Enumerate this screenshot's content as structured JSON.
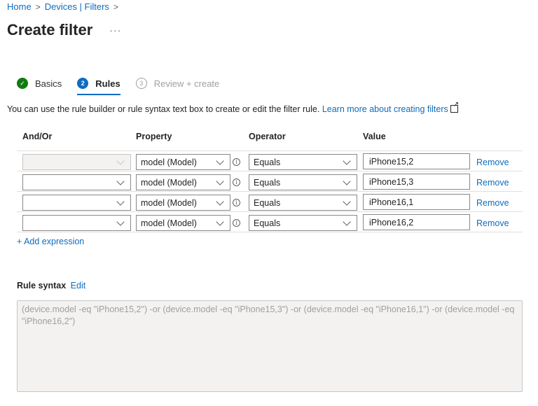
{
  "breadcrumb": {
    "items": [
      "Home",
      "Devices | Filters"
    ],
    "separator": ">"
  },
  "page": {
    "title": "Create filter",
    "more_label": "···"
  },
  "steps": [
    {
      "label": "Basics",
      "state": "done",
      "indicator": "✓"
    },
    {
      "label": "Rules",
      "state": "active",
      "indicator": "2"
    },
    {
      "label": "Review + create",
      "state": "todo",
      "indicator": "3"
    }
  ],
  "description": {
    "text": "You can use the rule builder or rule syntax text box to create or edit the filter rule.",
    "link": "Learn more about creating filters"
  },
  "table": {
    "headers": {
      "andor": "And/Or",
      "property": "Property",
      "operator": "Operator",
      "value": "Value"
    },
    "rows": [
      {
        "andor": "",
        "andor_disabled": true,
        "property": "model (Model)",
        "operator": "Equals",
        "value": "iPhone15,2",
        "remove": "Remove"
      },
      {
        "andor": "",
        "andor_disabled": false,
        "property": "model (Model)",
        "operator": "Equals",
        "value": "iPhone15,3",
        "remove": "Remove"
      },
      {
        "andor": "",
        "andor_disabled": false,
        "property": "model (Model)",
        "operator": "Equals",
        "value": "iPhone16,1",
        "remove": "Remove"
      },
      {
        "andor": "",
        "andor_disabled": false,
        "property": "model (Model)",
        "operator": "Equals",
        "value": "iPhone16,2",
        "remove": "Remove"
      }
    ],
    "info_glyph": "i"
  },
  "add_expression": "+ Add expression",
  "rule_syntax": {
    "title": "Rule syntax",
    "edit_label": "Edit",
    "text": "(device.model -eq \"iPhone15,2\") -or (device.model -eq \"iPhone15,3\") -or (device.model -eq \"iPhone16,1\") -or (device.model -eq \"iPhone16,2\")"
  },
  "colors": {
    "accent": "#0f6cbd",
    "success": "#107c10",
    "disabled_bg": "#f3f2f1",
    "muted_text": "#a19f9d"
  }
}
